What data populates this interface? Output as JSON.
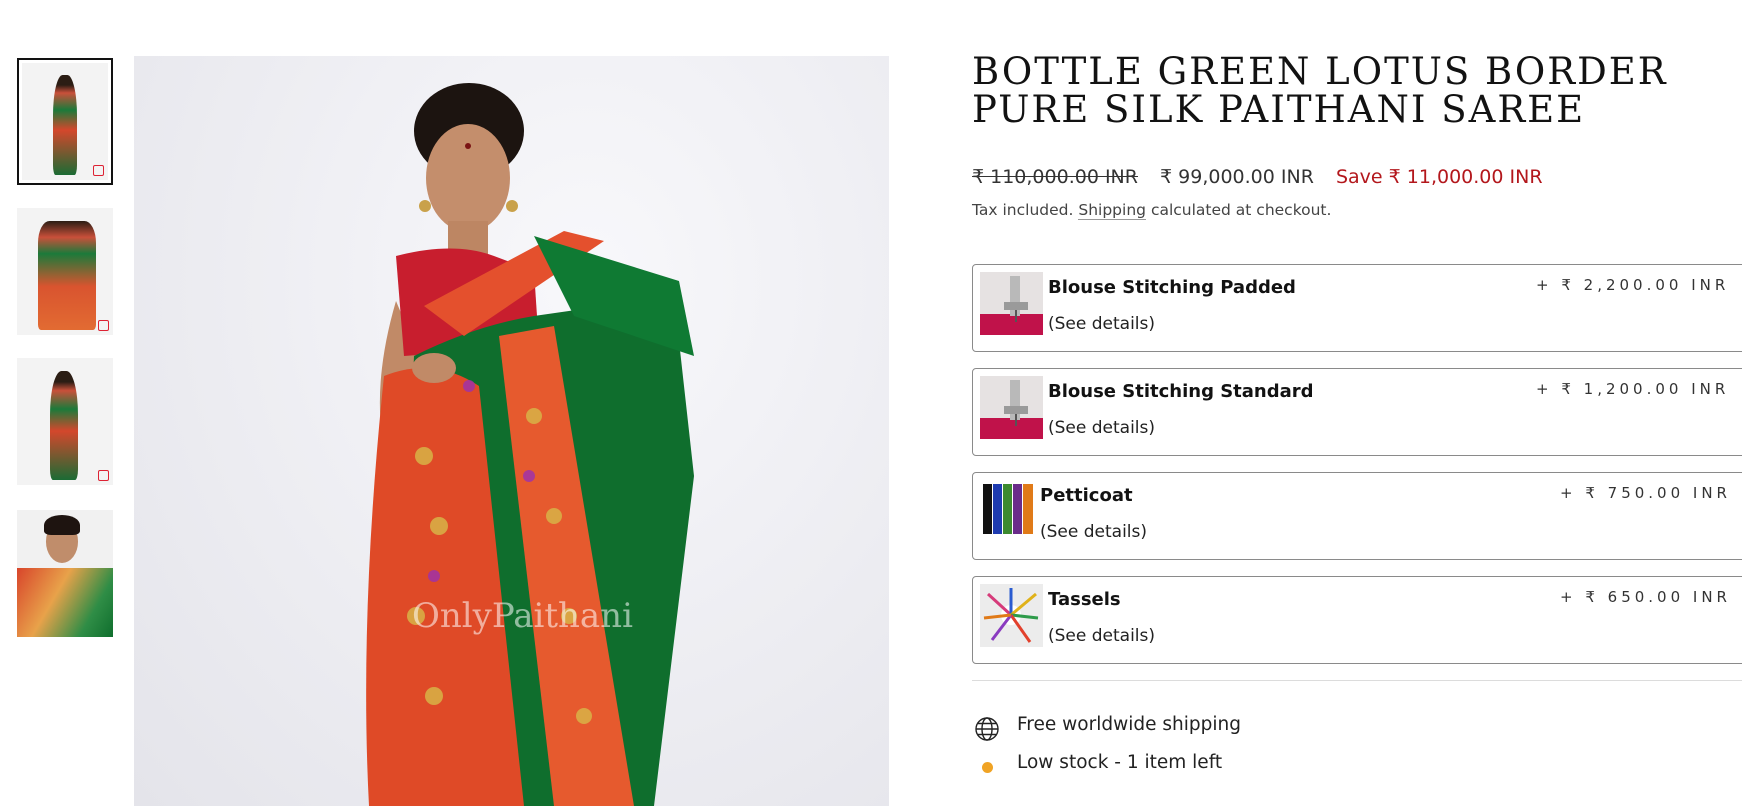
{
  "product": {
    "title": "BOTTLE GREEN LOTUS BORDER PURE SILK PAITHANI SAREE",
    "price_original": "₹ 110,000.00 INR",
    "price_sale": "₹ 99,000.00 INR",
    "price_save": "Save ₹ 11,000.00 INR",
    "tax_prefix": "Tax included.",
    "tax_link": "Shipping",
    "tax_suffix": "calculated at checkout.",
    "watermark": "OnlyPaithani"
  },
  "gallery": {
    "thumbnails": [
      {
        "name": "front view",
        "active": true
      },
      {
        "name": "pallu spread view",
        "active": false
      },
      {
        "name": "side view",
        "active": false
      },
      {
        "name": "close-up view",
        "active": false
      }
    ]
  },
  "addons": [
    {
      "name": "Blouse Stitching Padded",
      "details": "(See details)",
      "price": "+ ₹ 2,200.00 INR"
    },
    {
      "name": "Blouse Stitching Standard",
      "details": "(See details)",
      "price": "+ ₹ 1,200.00 INR"
    },
    {
      "name": "Petticoat",
      "details": "(See details)",
      "price": "+ ₹ 750.00 INR"
    },
    {
      "name": "Tassels",
      "details": "(See details)",
      "price": "+ ₹ 650.00 INR"
    }
  ],
  "info": {
    "shipping": "Free worldwide shipping",
    "shipping_icon": "globe-icon",
    "stock": "Low stock - 1 item left",
    "stock_icon": "stock-dot-icon",
    "stock_color": "#f0a324"
  },
  "colors": {
    "sale_red": "#b3171c",
    "saree_green": "#0f6e2d",
    "border_orange": "#e4502d"
  }
}
